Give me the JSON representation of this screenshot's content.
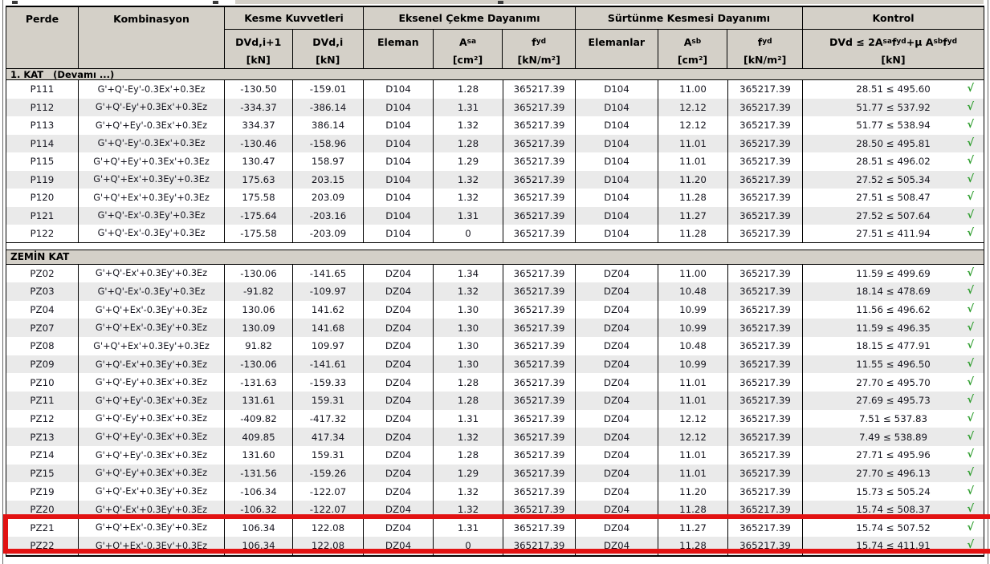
{
  "colors": {
    "header_bg": "#d4d0c8",
    "stripe": "#eaeaea",
    "border": "#000000",
    "text": "#15151f",
    "header_text": "#000000",
    "check_green": "#2f9e2f",
    "highlight_red": "#e21212",
    "panel_line": "#6a6a6a"
  },
  "table": {
    "header": {
      "perde": "Perde",
      "kombinasyon": "Kombinasyon",
      "kesme": "Kesme Kuvvetleri",
      "eksenel": "Eksenel Çekme Dayanımı",
      "surtunme": "Sürtünme Kesmesi Dayanımı",
      "kontrol": "Kontrol",
      "sub": [
        {
          "name": "dvd-i1",
          "label": [
            {
              "t": "DVd,i+1"
            }
          ],
          "unit": "[kN]"
        },
        {
          "name": "dvd-i",
          "label": [
            {
              "t": "DVd,i"
            }
          ],
          "unit": "[kN]"
        },
        {
          "name": "eleman",
          "label": [
            {
              "t": "Eleman"
            }
          ],
          "unit": ""
        },
        {
          "name": "asa",
          "label": [
            {
              "t": "A"
            },
            {
              "t": "sa",
              "sub": true
            }
          ],
          "unit": "[cm²]"
        },
        {
          "name": "fyd-a",
          "label": [
            {
              "t": "f"
            },
            {
              "t": "yd",
              "sub": true
            }
          ],
          "unit": "[kN/m²]"
        },
        {
          "name": "elemanlar",
          "label": [
            {
              "t": "Elemanlar"
            }
          ],
          "unit": ""
        },
        {
          "name": "asb",
          "label": [
            {
              "t": "A"
            },
            {
              "t": "sb",
              "sub": true
            }
          ],
          "unit": "[cm²]"
        },
        {
          "name": "fyd-b",
          "label": [
            {
              "t": "f"
            },
            {
              "t": "yd",
              "sub": true
            }
          ],
          "unit": "[kN/m²]"
        },
        {
          "name": "kontrol-formula",
          "label": [
            {
              "t": "DVd ≤ 2A"
            },
            {
              "t": "sa",
              "sub": true
            },
            {
              "t": "f"
            },
            {
              "t": "yd",
              "sub": true
            },
            {
              "t": "+μ A"
            },
            {
              "t": "sb",
              "sub": true
            },
            {
              "t": "f"
            },
            {
              "t": "yd",
              "sub": true
            }
          ],
          "unit": "[kN]"
        }
      ]
    },
    "col_names": [
      "perde",
      "kombinasyon",
      "dvd-i1",
      "dvd-i",
      "eleman",
      "asa",
      "fyd-a",
      "elemanlar",
      "asb",
      "fyd-b",
      "kontrol"
    ],
    "check_glyph": "√",
    "sections": [
      {
        "title": "1. KAT   (Devamı ...)",
        "rows": [
          [
            "P111",
            "G'+Q'-Ey'-0.3Ex'+0.3Ez",
            "-130.50",
            "-159.01",
            "D104",
            "1.28",
            "365217.39",
            "D104",
            "11.00",
            "365217.39",
            "28.51 ≤ 495.60"
          ],
          [
            "P112",
            "G'+Q'-Ey'+0.3Ex'+0.3Ez",
            "-334.37",
            "-386.14",
            "D104",
            "1.31",
            "365217.39",
            "D104",
            "12.12",
            "365217.39",
            "51.77 ≤ 537.92"
          ],
          [
            "P113",
            "G'+Q'+Ey'-0.3Ex'+0.3Ez",
            "334.37",
            "386.14",
            "D104",
            "1.32",
            "365217.39",
            "D104",
            "12.12",
            "365217.39",
            "51.77 ≤ 538.94"
          ],
          [
            "P114",
            "G'+Q'-Ey'-0.3Ex'+0.3Ez",
            "-130.46",
            "-158.96",
            "D104",
            "1.28",
            "365217.39",
            "D104",
            "11.01",
            "365217.39",
            "28.50 ≤ 495.81"
          ],
          [
            "P115",
            "G'+Q'+Ey'+0.3Ex'+0.3Ez",
            "130.47",
            "158.97",
            "D104",
            "1.29",
            "365217.39",
            "D104",
            "11.01",
            "365217.39",
            "28.51 ≤ 496.02"
          ],
          [
            "P119",
            "G'+Q'+Ex'+0.3Ey'+0.3Ez",
            "175.63",
            "203.15",
            "D104",
            "1.32",
            "365217.39",
            "D104",
            "11.20",
            "365217.39",
            "27.52 ≤ 505.34"
          ],
          [
            "P120",
            "G'+Q'+Ex'+0.3Ey'+0.3Ez",
            "175.58",
            "203.09",
            "D104",
            "1.32",
            "365217.39",
            "D104",
            "11.28",
            "365217.39",
            "27.51 ≤ 508.47"
          ],
          [
            "P121",
            "G'+Q'-Ex'-0.3Ey'+0.3Ez",
            "-175.64",
            "-203.16",
            "D104",
            "1.31",
            "365217.39",
            "D104",
            "11.27",
            "365217.39",
            "27.52 ≤ 507.64"
          ],
          [
            "P122",
            "G'+Q'-Ex'-0.3Ey'+0.3Ez",
            "-175.58",
            "-203.09",
            "D104",
            "0",
            "365217.39",
            "D104",
            "11.28",
            "365217.39",
            "27.51 ≤ 411.94"
          ]
        ]
      },
      {
        "title": "ZEMİN KAT",
        "rows": [
          [
            "PZ02",
            "G'+Q'-Ex'+0.3Ey'+0.3Ez",
            "-130.06",
            "-141.65",
            "DZ04",
            "1.34",
            "365217.39",
            "DZ04",
            "11.00",
            "365217.39",
            "11.59 ≤ 499.69"
          ],
          [
            "PZ03",
            "G'+Q'-Ex'-0.3Ey'+0.3Ez",
            "-91.82",
            "-109.97",
            "DZ04",
            "1.32",
            "365217.39",
            "DZ04",
            "10.48",
            "365217.39",
            "18.14 ≤ 478.69"
          ],
          [
            "PZ04",
            "G'+Q'+Ex'-0.3Ey'+0.3Ez",
            "130.06",
            "141.62",
            "DZ04",
            "1.30",
            "365217.39",
            "DZ04",
            "10.99",
            "365217.39",
            "11.56 ≤ 496.62"
          ],
          [
            "PZ07",
            "G'+Q'+Ex'-0.3Ey'+0.3Ez",
            "130.09",
            "141.68",
            "DZ04",
            "1.30",
            "365217.39",
            "DZ04",
            "10.99",
            "365217.39",
            "11.59 ≤ 496.35"
          ],
          [
            "PZ08",
            "G'+Q'+Ex'+0.3Ey'+0.3Ez",
            "91.82",
            "109.97",
            "DZ04",
            "1.30",
            "365217.39",
            "DZ04",
            "10.48",
            "365217.39",
            "18.15 ≤ 477.91"
          ],
          [
            "PZ09",
            "G'+Q'-Ex'+0.3Ey'+0.3Ez",
            "-130.06",
            "-141.61",
            "DZ04",
            "1.30",
            "365217.39",
            "DZ04",
            "10.99",
            "365217.39",
            "11.55 ≤ 496.50"
          ],
          [
            "PZ10",
            "G'+Q'-Ey'+0.3Ex'+0.3Ez",
            "-131.63",
            "-159.33",
            "DZ04",
            "1.28",
            "365217.39",
            "DZ04",
            "11.01",
            "365217.39",
            "27.70 ≤ 495.70"
          ],
          [
            "PZ11",
            "G'+Q'+Ey'-0.3Ex'+0.3Ez",
            "131.61",
            "159.31",
            "DZ04",
            "1.28",
            "365217.39",
            "DZ04",
            "11.01",
            "365217.39",
            "27.69 ≤ 495.73"
          ],
          [
            "PZ12",
            "G'+Q'-Ey'+0.3Ex'+0.3Ez",
            "-409.82",
            "-417.32",
            "DZ04",
            "1.31",
            "365217.39",
            "DZ04",
            "12.12",
            "365217.39",
            "7.51 ≤ 537.83"
          ],
          [
            "PZ13",
            "G'+Q'+Ey'-0.3Ex'+0.3Ez",
            "409.85",
            "417.34",
            "DZ04",
            "1.32",
            "365217.39",
            "DZ04",
            "12.12",
            "365217.39",
            "7.49 ≤ 538.89"
          ],
          [
            "PZ14",
            "G'+Q'+Ey'-0.3Ex'+0.3Ez",
            "131.60",
            "159.31",
            "DZ04",
            "1.28",
            "365217.39",
            "DZ04",
            "11.01",
            "365217.39",
            "27.71 ≤ 495.96"
          ],
          [
            "PZ15",
            "G'+Q'-Ey'+0.3Ex'+0.3Ez",
            "-131.56",
            "-159.26",
            "DZ04",
            "1.29",
            "365217.39",
            "DZ04",
            "11.01",
            "365217.39",
            "27.70 ≤ 496.13"
          ],
          [
            "PZ19",
            "G'+Q'-Ex'+0.3Ey'+0.3Ez",
            "-106.34",
            "-122.07",
            "DZ04",
            "1.32",
            "365217.39",
            "DZ04",
            "11.20",
            "365217.39",
            "15.73 ≤ 505.24"
          ],
          [
            "PZ20",
            "G'+Q'-Ex'+0.3Ey'+0.3Ez",
            "-106.32",
            "-122.07",
            "DZ04",
            "1.32",
            "365217.39",
            "DZ04",
            "11.28",
            "365217.39",
            "15.74 ≤ 508.37"
          ],
          [
            "PZ21",
            "G'+Q'+Ex'-0.3Ey'+0.3Ez",
            "106.34",
            "122.08",
            "DZ04",
            "1.31",
            "365217.39",
            "DZ04",
            "11.27",
            "365217.39",
            "15.74 ≤ 507.52"
          ],
          [
            "PZ22",
            "G'+Q'+Ex'-0.3Ey'+0.3Ez",
            "106.34",
            "122.08",
            "DZ04",
            "0",
            "365217.39",
            "DZ04",
            "11.28",
            "365217.39",
            "15.74 ≤ 411.91"
          ]
        ]
      }
    ]
  },
  "highlight": {
    "row": "PZ21"
  }
}
